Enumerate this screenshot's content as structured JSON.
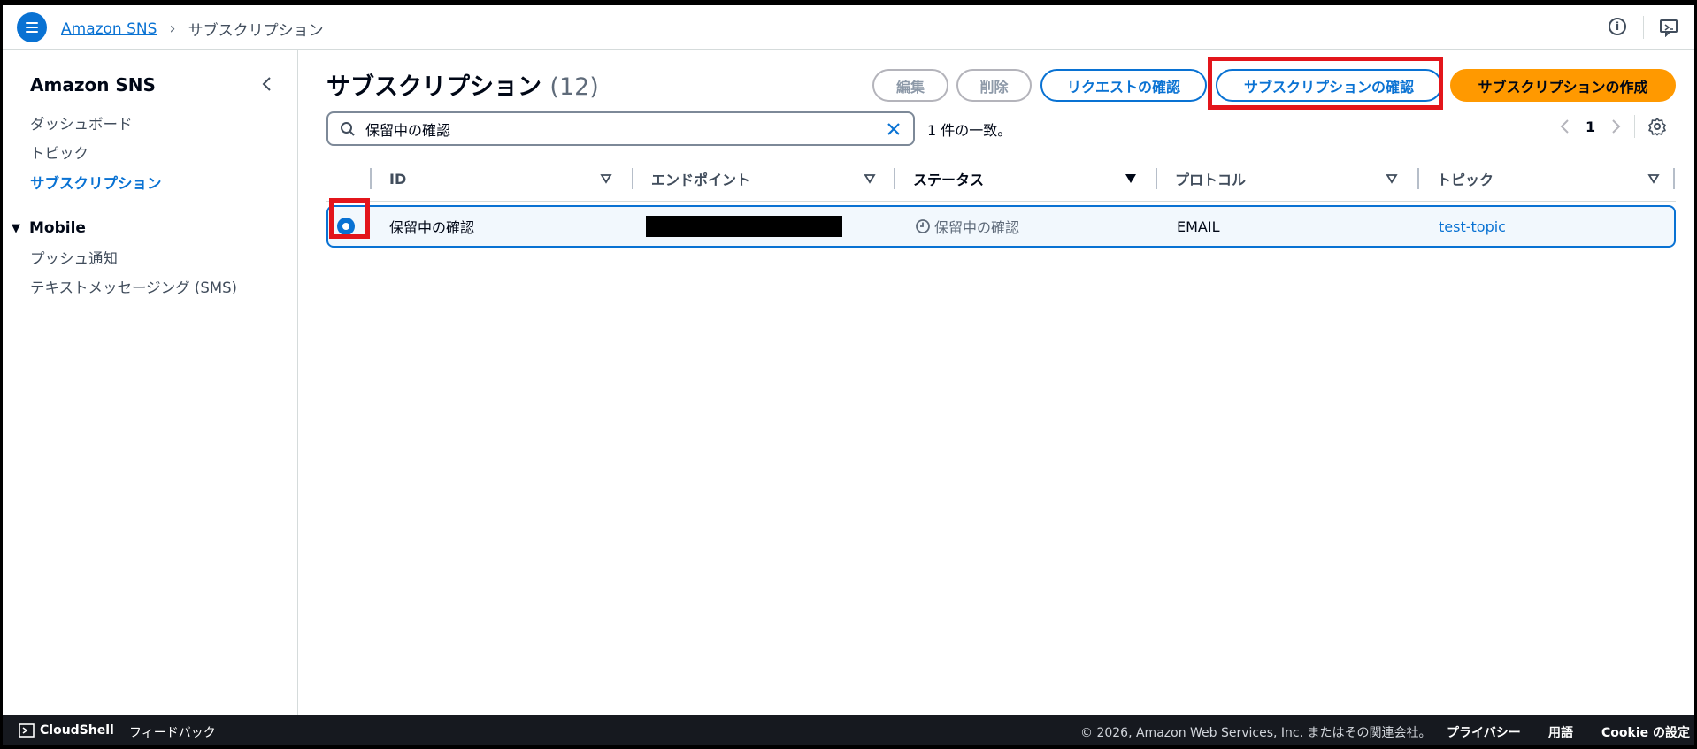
{
  "breadcrumb": {
    "service": "Amazon SNS",
    "current": "サブスクリプション"
  },
  "sidebar": {
    "title": "Amazon SNS",
    "items": [
      {
        "label": "ダッシュボード"
      },
      {
        "label": "トピック"
      },
      {
        "label": "サブスクリプション"
      }
    ],
    "section": "Mobile",
    "section_items": [
      {
        "label": "プッシュ通知"
      },
      {
        "label": "テキストメッセージング (SMS)"
      }
    ]
  },
  "page": {
    "title": "サブスクリプション",
    "count": "(12)"
  },
  "buttons": {
    "edit": "編集",
    "delete": "削除",
    "request_confirm": "リクエストの確認",
    "confirm_subscription": "サブスクリプションの確認",
    "create_subscription": "サブスクリプションの作成"
  },
  "search": {
    "value": "保留中の確認",
    "match": "1 件の一致。"
  },
  "pager": {
    "page": "1"
  },
  "table": {
    "headers": [
      "ID",
      "エンドポイント",
      "ステータス",
      "プロトコル",
      "トピック"
    ],
    "rows": [
      {
        "id": "保留中の確認",
        "status": "保留中の確認",
        "protocol": "EMAIL",
        "topic": "test-topic"
      }
    ]
  },
  "footer": {
    "cloudshell": "CloudShell",
    "feedback": "フィードバック",
    "copyright": "© 2026, Amazon Web Services, Inc. またはその関連会社。",
    "privacy": "プライバシー",
    "terms": "用語",
    "cookie": "Cookie の設定"
  },
  "colors": {
    "accent": "#0972d3",
    "primary_button": "#ff9900",
    "highlight": "#e3151b"
  }
}
